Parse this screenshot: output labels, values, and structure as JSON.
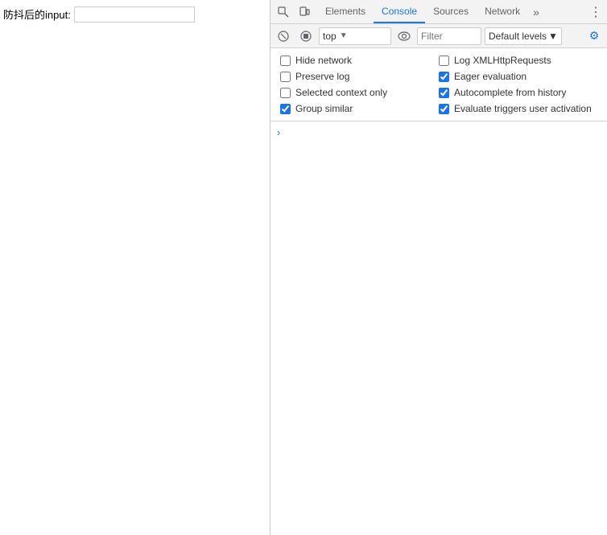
{
  "page": {
    "label": "防抖后的input:",
    "input_value": "",
    "input_placeholder": ""
  },
  "devtools": {
    "tabs": [
      {
        "id": "elements",
        "label": "Elements",
        "active": false
      },
      {
        "id": "console",
        "label": "Console",
        "active": true
      },
      {
        "id": "sources",
        "label": "Sources",
        "active": false
      },
      {
        "id": "network",
        "label": "Network",
        "active": false
      }
    ],
    "console_toolbar": {
      "context": "top",
      "filter_placeholder": "Filter",
      "default_levels": "Default levels"
    },
    "settings": {
      "left_column": [
        {
          "label": "Hide network",
          "checked": false
        },
        {
          "label": "Preserve log",
          "checked": false
        },
        {
          "label": "Selected context only",
          "checked": false
        },
        {
          "label": "Group similar",
          "checked": true
        }
      ],
      "right_column": [
        {
          "label": "Log XMLHttpRequests",
          "checked": false
        },
        {
          "label": "Eager evaluation",
          "checked": true
        },
        {
          "label": "Autocomplete from history",
          "checked": true
        },
        {
          "label": "Evaluate triggers user activation",
          "checked": true
        }
      ]
    }
  }
}
